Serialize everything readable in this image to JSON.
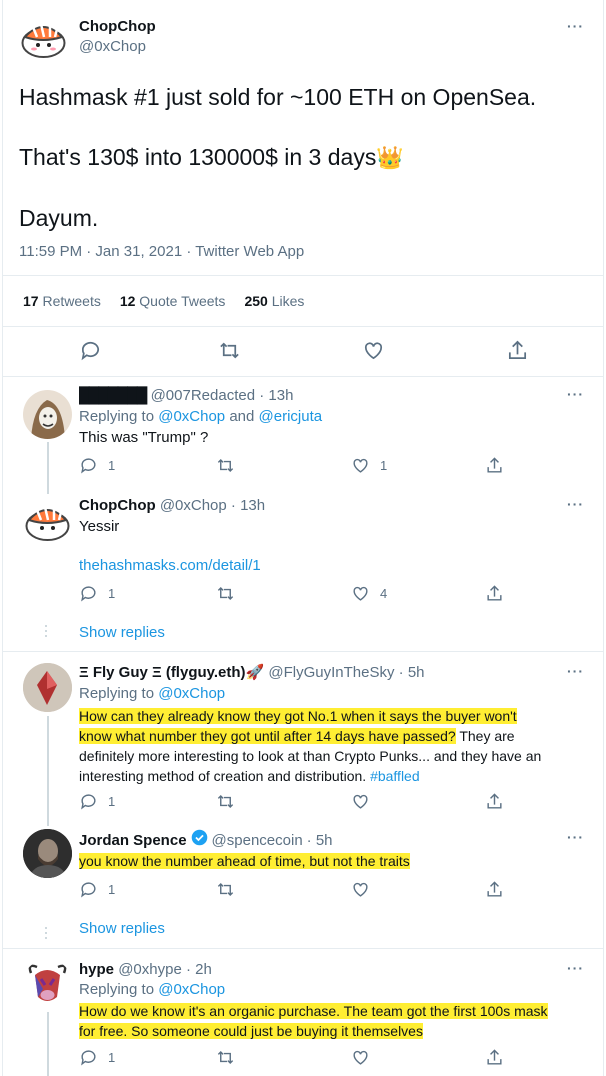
{
  "main_tweet": {
    "author_name": "ChopChop",
    "author_handle": "@0xChop",
    "text_line1": "Hashmask #1 just sold for ~100 ETH on OpenSea.",
    "text_line2": "That's 130$ into 130000$ in 3 days",
    "text_emoji": "👑",
    "text_line3": "Dayum.",
    "timestamp": "11:59 PM · Jan 31, 2021 · Twitter Web App",
    "retweets_count": "17",
    "retweets_label": "Retweets",
    "quotes_count": "12",
    "quotes_label": "Quote Tweets",
    "likes_count": "250",
    "likes_label": "Likes"
  },
  "replies": [
    {
      "author_name": "███████",
      "author_handle": "@007Redacted",
      "time": "· 13h",
      "replying_prefix": "Replying to",
      "replying_to": "@0xChop",
      "replying_and": "and",
      "replying_to2": "@ericjuta",
      "text": "This was \"Trump\" ?",
      "reply_count": "1",
      "like_count": "1"
    },
    {
      "author_name": "ChopChop",
      "author_handle": "@0xChop",
      "time": "· 13h",
      "text": "Yessir",
      "link": "thehashmasks.com/detail/1",
      "reply_count": "1",
      "like_count": "4",
      "show_replies": "Show replies"
    },
    {
      "author_name": "Ξ Fly Guy Ξ (flyguy.eth)",
      "author_emoji": "🚀",
      "author_handle": "@FlyGuyInTheSky",
      "time": "· 5h",
      "replying_prefix": "Replying to",
      "replying_to": "@0xChop",
      "text_line1": "How can they already know they got No.1 when it says the buyer won't",
      "text_line2": "know what number they got until after 14 days have passed?",
      "text_line2b": " They are",
      "text_line3": "definitely more interesting to look at than Crypto Punks... and they have an",
      "text_line4": "interesting method of creation and distribution.",
      "hashtag": "#baffled",
      "reply_count": "1"
    },
    {
      "author_name": "Jordan Spence",
      "author_handle": "@spencecoin",
      "time": "· 5h",
      "text": "you know the number ahead of time, but not the traits",
      "reply_count": "1",
      "show_replies": "Show replies"
    },
    {
      "author_name": "hype",
      "author_handle": "@0xhype",
      "time": "· 2h",
      "replying_prefix": "Replying to",
      "replying_to": "@0xChop",
      "text_line1": "How do we know it's an organic purchase. The team got the first 100s mask",
      "text_line2": "for free. So someone could just be buying it themselves",
      "reply_count": "1"
    }
  ],
  "more_label": "···",
  "colors": {
    "link": "#1b95e0",
    "secondary": "#5b7083",
    "highlight": "#ffee33",
    "verified": "#1da1f2"
  }
}
